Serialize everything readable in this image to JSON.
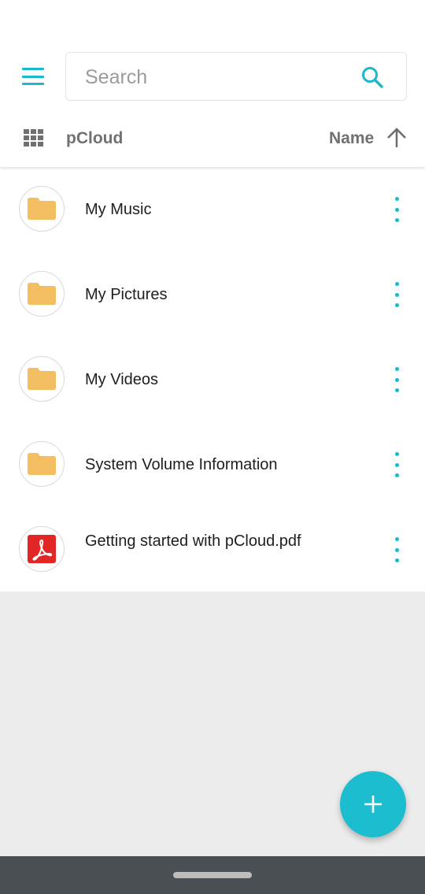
{
  "search": {
    "placeholder": "Search"
  },
  "header": {
    "breadcrumb": "pCloud",
    "sort_label": "Name"
  },
  "items": [
    {
      "name": "My Music",
      "type": "folder",
      "icon": "folder-icon"
    },
    {
      "name": "My Pictures",
      "type": "folder",
      "icon": "folder-icon"
    },
    {
      "name": "My Videos",
      "type": "folder",
      "icon": "folder-icon"
    },
    {
      "name": "System Volume Information",
      "type": "folder",
      "icon": "folder-icon"
    },
    {
      "name": "Getting started with pCloud.pdf",
      "type": "pdf",
      "icon": "pdf-icon"
    }
  ],
  "colors": {
    "accent": "#1ab9cc",
    "folder": "#f3bd62",
    "pdf": "#e22625",
    "fab": "#1cbdcf"
  }
}
